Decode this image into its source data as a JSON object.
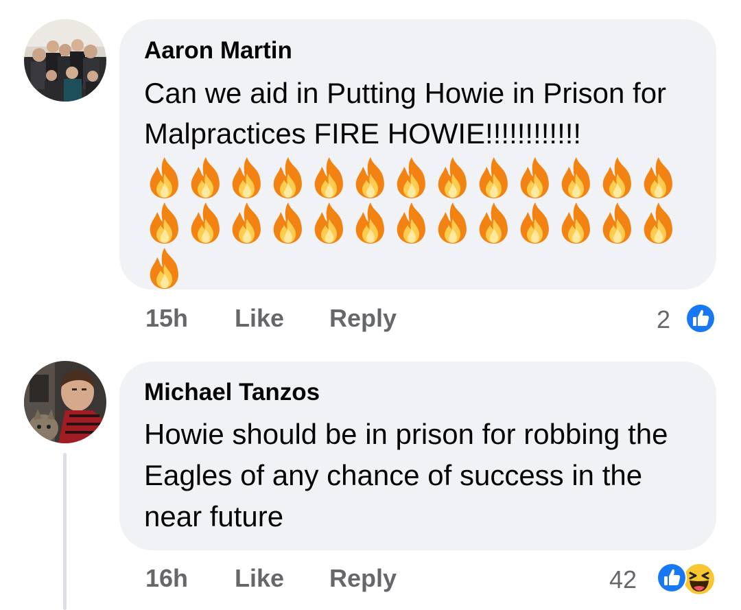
{
  "comments": [
    {
      "author": "Aaron Martin",
      "text": "Can we aid in Putting Howie in Prison for Malpractices FIRE HOWIE!!!!!!!!!!!!",
      "fire_emoji_count": 27,
      "fire_emoji": "fire-emoji",
      "time": "15h",
      "like_label": "Like",
      "reply_label": "Reply",
      "reaction_count": "2",
      "reactions": [
        "like-reaction-icon"
      ]
    },
    {
      "author": "Michael Tanzos",
      "text": "Howie should be in prison for robbing the Eagles of any chance of success in the near future",
      "time": "16h",
      "like_label": "Like",
      "reply_label": "Reply",
      "reaction_count": "42",
      "reactions": [
        "like-reaction-icon",
        "haha-reaction-icon"
      ]
    }
  ],
  "colors": {
    "bubble": "#f0f2f5",
    "text": "#050505",
    "meta": "#65676b",
    "like_blue": "#1877f2",
    "thread_line": "#dcdfe3"
  }
}
